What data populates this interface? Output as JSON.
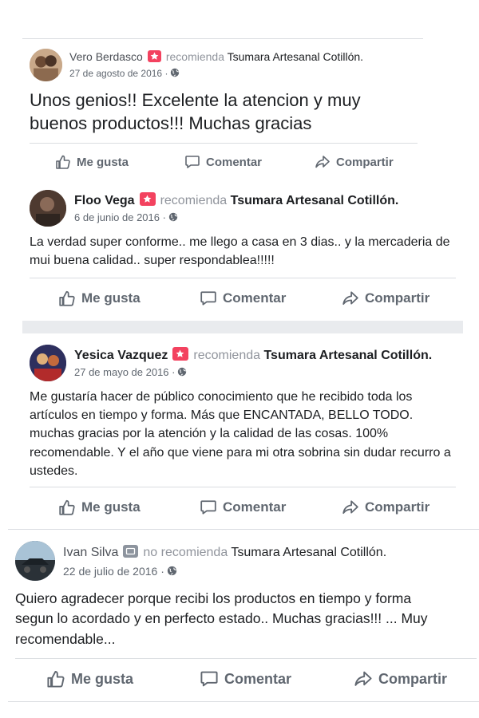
{
  "posts": [
    {
      "author": "Vero Berdasco",
      "verb": "recomienda",
      "page": "Tsumara Artesanal Cotillón.",
      "date": "27 de agosto de 2016 ·",
      "text": "Unos genios!! Excelente la atencion y muy buenos productos!!! Muchas gracias",
      "like": "Me gusta",
      "comment": "Comentar",
      "share": "Compartir",
      "recommends": true
    },
    {
      "author": "Floo Vega",
      "verb": "recomienda",
      "page": "Tsumara Artesanal Cotillón.",
      "date": "6 de junio de 2016 ·",
      "text": "La verdad super conforme.. me llego a casa en 3 dias.. y la mercaderia de mui buena calidad..  super respondablea!!!!!",
      "like": "Me gusta",
      "comment": "Comentar",
      "share": "Compartir",
      "recommends": true
    },
    {
      "author": "Yesica Vazquez",
      "verb": "recomienda",
      "page": "Tsumara Artesanal Cotillón.",
      "date": "27 de mayo de 2016 ·",
      "text": "Me gustaría hacer de público conocimiento que he recibido toda los artículos en tiempo y forma. Más que ENCANTADA, BELLO TODO. muchas gracias por la atención y la calidad de las cosas. 100% recomendable. Y el año que viene para mi otra sobrina sin dudar recurro a ustedes.",
      "like": "Me gusta",
      "comment": "Comentar",
      "share": "Compartir",
      "recommends": true
    },
    {
      "author": "Ivan Silva",
      "verb": "no recomienda",
      "page": "Tsumara Artesanal Cotillón.",
      "date": "22 de julio de 2016 ·",
      "text": "Quiero agradecer porque recibi los productos en tiempo y forma segun lo acordado y en perfecto estado.. Muchas gracias!!! ... Muy recomendable...",
      "like": "Me gusta",
      "comment": "Comentar",
      "share": "Compartir",
      "recommends": false
    }
  ],
  "colors": {
    "recommend_badge": "#f3425f",
    "not_recommend_badge": "#8d949e",
    "author": "#365899",
    "muted": "#606770",
    "divider": "#dadde1"
  }
}
